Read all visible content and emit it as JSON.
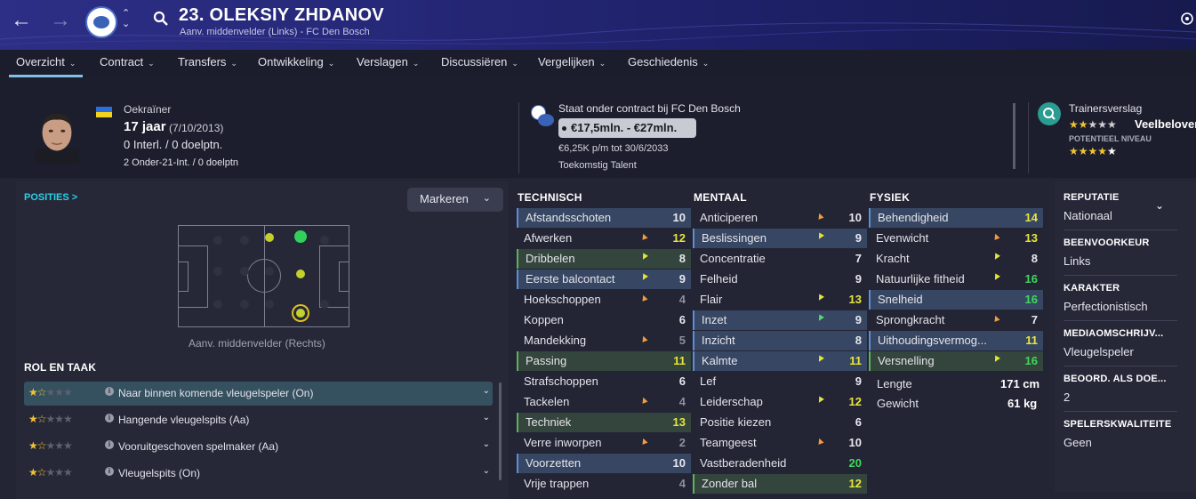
{
  "header": {
    "title": "23. OLEKSIY ZHDANOV",
    "subtitle": "Aanv. middenvelder (Links) - FC Den Bosch",
    "icons": [
      "back-arrow-icon",
      "forward-arrow-icon",
      "club-logo",
      "switch-chevrons-icon",
      "search-icon",
      "settings-icon"
    ]
  },
  "tabs": [
    "Overzicht",
    "Contract",
    "Transfers",
    "Ontwikkeling",
    "Verslagen",
    "Discussiëren",
    "Vergelijken",
    "Geschiedenis"
  ],
  "profile": {
    "nationality": "Oekraïner",
    "age": "17 jaar",
    "dob": "(7/10/2013)",
    "caps": "0 Interl. / 0 doelptn.",
    "u21": "2 Onder-21-Int. / 0 doelptn"
  },
  "contract": {
    "status": "Staat onder contract bij FC Den Bosch",
    "value": "€17,5mln. - €27mln.",
    "wage": "€6,25K p/m tot 30/6/2033",
    "tag": "Toekomstig Talent"
  },
  "coach": {
    "title": "Trainersverslag",
    "verdict": "Veelbelover",
    "potential_label": "POTENTIEEL NIVEAU",
    "current_stars": 2,
    "potential_stars": 4
  },
  "positions": {
    "title": "POSITIES >",
    "mark_button": "Markeren",
    "pitch_label": "Aanv. middenvelder (Rechts)"
  },
  "roles": {
    "title": "ROL EN TAAK",
    "items": [
      {
        "label": "Naar binnen komende vleugelspeler (On)",
        "stars": 1.5
      },
      {
        "label": "Hangende vleugelspits (Aa)",
        "stars": 1.5
      },
      {
        "label": "Vooruitgeschoven spelmaker (Aa)",
        "stars": 1.5
      },
      {
        "label": "Vleugelspits (On)",
        "stars": 1.5
      }
    ]
  },
  "attributes": {
    "technisch": {
      "title": "TECHNISCH",
      "rows": [
        {
          "name": "Afstandsschoten",
          "value": "10",
          "hl": "blue",
          "arrow": "",
          "vc": ""
        },
        {
          "name": "Afwerken",
          "value": "12",
          "hl": "",
          "arrow": "up",
          "vc": "y"
        },
        {
          "name": "Dribbelen",
          "value": "8",
          "hl": "green",
          "arrow": "dn",
          "vc": ""
        },
        {
          "name": "Eerste balcontact",
          "value": "9",
          "hl": "blue",
          "arrow": "dn",
          "vc": ""
        },
        {
          "name": "Hoekschoppen",
          "value": "4",
          "hl": "",
          "arrow": "up",
          "vc": "dim"
        },
        {
          "name": "Koppen",
          "value": "6",
          "hl": "",
          "arrow": "",
          "vc": ""
        },
        {
          "name": "Mandekking",
          "value": "5",
          "hl": "",
          "arrow": "up",
          "vc": "dim"
        },
        {
          "name": "Passing",
          "value": "11",
          "hl": "green",
          "arrow": "",
          "vc": "y"
        },
        {
          "name": "Strafschoppen",
          "value": "6",
          "hl": "",
          "arrow": "",
          "vc": ""
        },
        {
          "name": "Tackelen",
          "value": "4",
          "hl": "",
          "arrow": "up",
          "vc": "dim"
        },
        {
          "name": "Techniek",
          "value": "13",
          "hl": "green",
          "arrow": "",
          "vc": "y"
        },
        {
          "name": "Verre inworpen",
          "value": "2",
          "hl": "",
          "arrow": "up",
          "vc": "dim"
        },
        {
          "name": "Voorzetten",
          "value": "10",
          "hl": "blue",
          "arrow": "",
          "vc": ""
        },
        {
          "name": "Vrije trappen",
          "value": "4",
          "hl": "",
          "arrow": "",
          "vc": "dim"
        }
      ]
    },
    "mentaal": {
      "title": "MENTAAL",
      "rows": [
        {
          "name": "Anticiperen",
          "value": "10",
          "hl": "",
          "arrow": "up",
          "vc": ""
        },
        {
          "name": "Beslissingen",
          "value": "9",
          "hl": "blue",
          "arrow": "dn",
          "vc": ""
        },
        {
          "name": "Concentratie",
          "value": "7",
          "hl": "",
          "arrow": "",
          "vc": ""
        },
        {
          "name": "Felheid",
          "value": "9",
          "hl": "",
          "arrow": "",
          "vc": ""
        },
        {
          "name": "Flair",
          "value": "13",
          "hl": "",
          "arrow": "dn",
          "vc": "y"
        },
        {
          "name": "Inzet",
          "value": "9",
          "hl": "blue",
          "arrow": "gr",
          "vc": ""
        },
        {
          "name": "Inzicht",
          "value": "8",
          "hl": "blue",
          "arrow": "",
          "vc": ""
        },
        {
          "name": "Kalmte",
          "value": "11",
          "hl": "blue",
          "arrow": "dn",
          "vc": "y"
        },
        {
          "name": "Lef",
          "value": "9",
          "hl": "",
          "arrow": "",
          "vc": ""
        },
        {
          "name": "Leiderschap",
          "value": "12",
          "hl": "",
          "arrow": "dn",
          "vc": "y"
        },
        {
          "name": "Positie kiezen",
          "value": "6",
          "hl": "",
          "arrow": "",
          "vc": ""
        },
        {
          "name": "Teamgeest",
          "value": "10",
          "hl": "",
          "arrow": "up",
          "vc": ""
        },
        {
          "name": "Vastberadenheid",
          "value": "20",
          "hl": "",
          "arrow": "",
          "vc": "gr"
        },
        {
          "name": "Zonder bal",
          "value": "12",
          "hl": "green",
          "arrow": "",
          "vc": "y"
        }
      ]
    },
    "fysiek": {
      "title": "FYSIEK",
      "rows": [
        {
          "name": "Behendigheid",
          "value": "14",
          "hl": "blue",
          "arrow": "",
          "vc": "y"
        },
        {
          "name": "Evenwicht",
          "value": "13",
          "hl": "",
          "arrow": "up",
          "vc": "y"
        },
        {
          "name": "Kracht",
          "value": "8",
          "hl": "",
          "arrow": "dn",
          "vc": ""
        },
        {
          "name": "Natuurlijke fitheid",
          "value": "16",
          "hl": "",
          "arrow": "dn",
          "vc": "gr"
        },
        {
          "name": "Snelheid",
          "value": "16",
          "hl": "blue",
          "arrow": "",
          "vc": "gr"
        },
        {
          "name": "Sprongkracht",
          "value": "7",
          "hl": "",
          "arrow": "up",
          "vc": ""
        },
        {
          "name": "Uithoudingsvermog...",
          "value": "11",
          "hl": "blue",
          "arrow": "",
          "vc": "y"
        },
        {
          "name": "Versnelling",
          "value": "16",
          "hl": "green",
          "arrow": "dn",
          "vc": "gr"
        }
      ],
      "length_label": "Lengte",
      "length": "171 cm",
      "weight_label": "Gewicht",
      "weight": "61 kg"
    }
  },
  "info": [
    {
      "label": "REPUTATIE",
      "value": "Nationaal"
    },
    {
      "label": "BEENVOORKEUR",
      "value": "Links"
    },
    {
      "label": "KARAKTER",
      "value": "Perfectionistisch"
    },
    {
      "label": "MEDIAOMSCHRIJV...",
      "value": "Vleugelspeler"
    },
    {
      "label": "BEOORD. ALS DOE...",
      "value": "2"
    },
    {
      "label": "SPELERSKWALITEITE",
      "value": "Geen"
    }
  ],
  "colors": {
    "accent": "#2ad1e6",
    "blue_hl": "#374763",
    "green_hl": "#34453d",
    "yellow": "#e6e63a",
    "green": "#3ed95a",
    "orange": "#f39c3a"
  }
}
